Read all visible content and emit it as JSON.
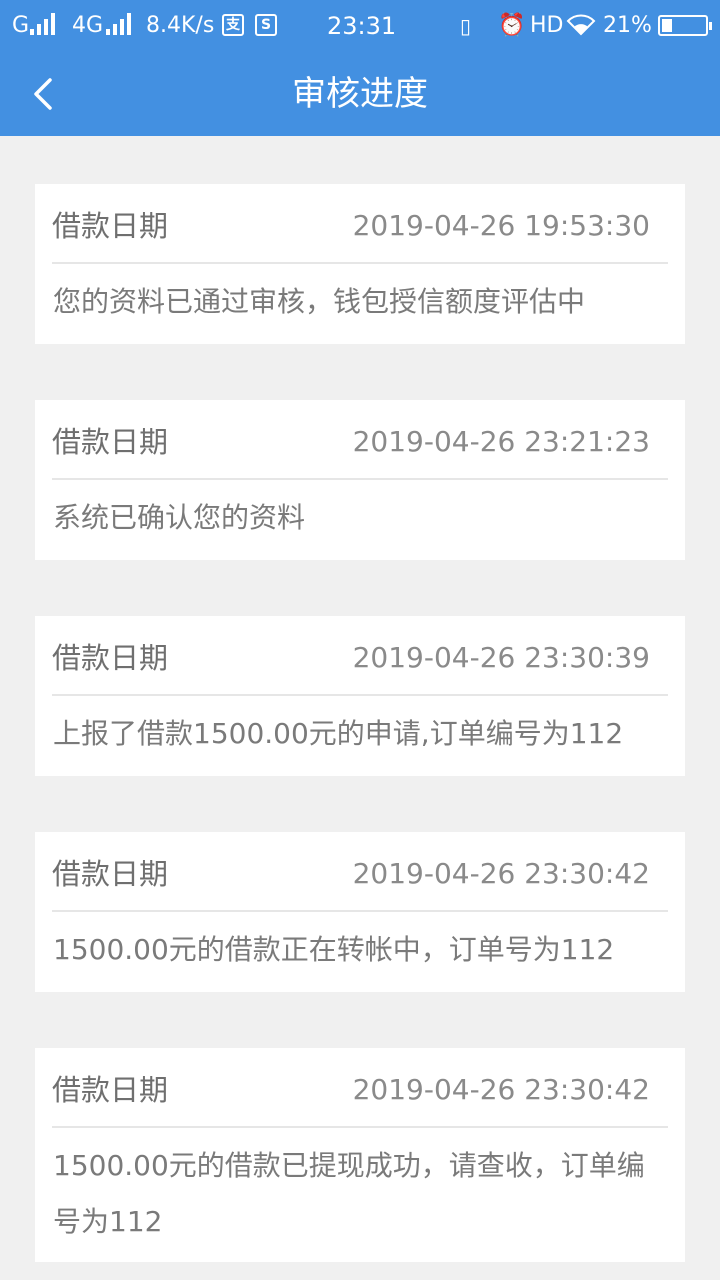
{
  "status_bar": {
    "carrier1": "G",
    "carrier2": "4G",
    "speed": "8.4K/s",
    "pay_badge_1": "支",
    "pay_badge_2": "S",
    "time": "23:31",
    "hd": "HD",
    "battery": "21%",
    "battery_level": 0.21
  },
  "nav": {
    "title": "审核进度"
  },
  "records": [
    {
      "label": "借款日期",
      "date": "2019-04-26 19:53:30",
      "message": "您的资料已通过审核，钱包授信额度评估中"
    },
    {
      "label": "借款日期",
      "date": "2019-04-26 23:21:23",
      "message": "系统已确认您的资料"
    },
    {
      "label": "借款日期",
      "date": "2019-04-26 23:30:39",
      "message": "上报了借款1500.00元的申请,订单编号为112"
    },
    {
      "label": "借款日期",
      "date": "2019-04-26 23:30:42",
      "message": "1500.00元的借款正在转帐中，订单号为112"
    },
    {
      "label": "借款日期",
      "date": "2019-04-26 23:30:42",
      "message": "1500.00元的借款已提现成功，请查收，订单编号为112"
    }
  ]
}
